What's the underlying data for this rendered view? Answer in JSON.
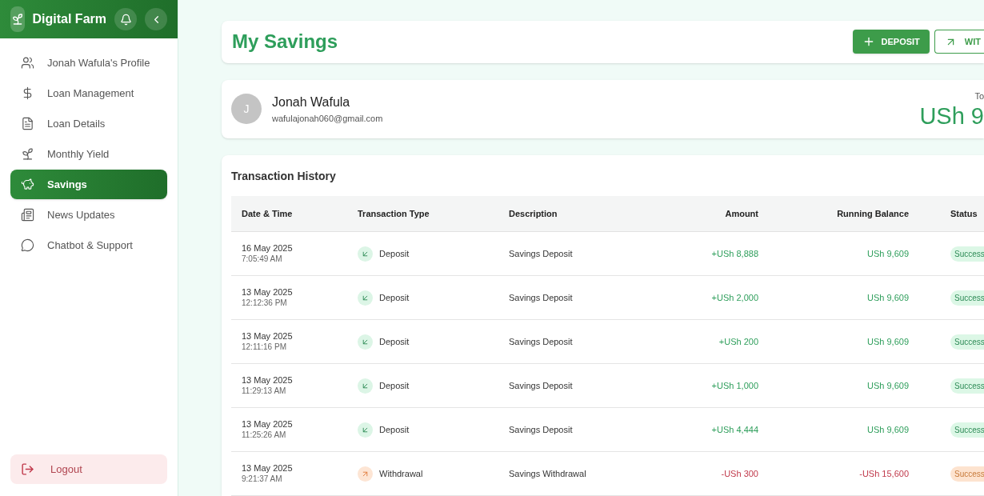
{
  "sidebar": {
    "brand": "Digital Farm",
    "items": [
      {
        "label": "Jonah Wafula's Profile",
        "selected": false
      },
      {
        "label": "Loan Management",
        "selected": false
      },
      {
        "label": "Loan Details",
        "selected": false
      },
      {
        "label": "Monthly Yield",
        "selected": false
      },
      {
        "label": "Savings",
        "selected": true
      },
      {
        "label": "News Updates",
        "selected": false
      },
      {
        "label": "Chatbot & Support",
        "selected": false
      }
    ],
    "logout": "Logout"
  },
  "page_title": "My Savings",
  "actions": [
    {
      "label": "DEPOSIT",
      "kind": "primary"
    },
    {
      "label": "WIT",
      "kind": "outline"
    }
  ],
  "profile": {
    "initial": "J",
    "name": "Jonah Wafula",
    "email": "wafulajonah060@gmail.com",
    "total_label": "To",
    "total_value": "USh 9"
  },
  "table": {
    "title": "Transaction History",
    "columns": [
      "Date & Time",
      "Transaction Type",
      "Description",
      "Amount",
      "Running Balance",
      "Status"
    ],
    "rows": [
      {
        "date": "16 May 2025",
        "time": "7:05:49 AM",
        "kind": "deposit",
        "type": "Deposit",
        "description": "Savings Deposit",
        "amount": "+USh 8,888",
        "balance": "USh 9,609",
        "status": "Success"
      },
      {
        "date": "13 May 2025",
        "time": "12:12:36 PM",
        "kind": "deposit",
        "type": "Deposit",
        "description": "Savings Deposit",
        "amount": "+USh 2,000",
        "balance": "USh 9,609",
        "status": "Success"
      },
      {
        "date": "13 May 2025",
        "time": "12:11:16 PM",
        "kind": "deposit",
        "type": "Deposit",
        "description": "Savings Deposit",
        "amount": "+USh 200",
        "balance": "USh 9,609",
        "status": "Success"
      },
      {
        "date": "13 May 2025",
        "time": "11:29:13 AM",
        "kind": "deposit",
        "type": "Deposit",
        "description": "Savings Deposit",
        "amount": "+USh 1,000",
        "balance": "USh 9,609",
        "status": "Success"
      },
      {
        "date": "13 May 2025",
        "time": "11:25:26 AM",
        "kind": "deposit",
        "type": "Deposit",
        "description": "Savings Deposit",
        "amount": "+USh 4,444",
        "balance": "USh 9,609",
        "status": "Success"
      },
      {
        "date": "13 May 2025",
        "time": "9:21:37 AM",
        "kind": "withdrawal",
        "type": "Withdrawal",
        "description": "Savings Withdrawal",
        "amount": "-USh 300",
        "balance": "-USh 15,600",
        "status": "Success"
      }
    ]
  }
}
